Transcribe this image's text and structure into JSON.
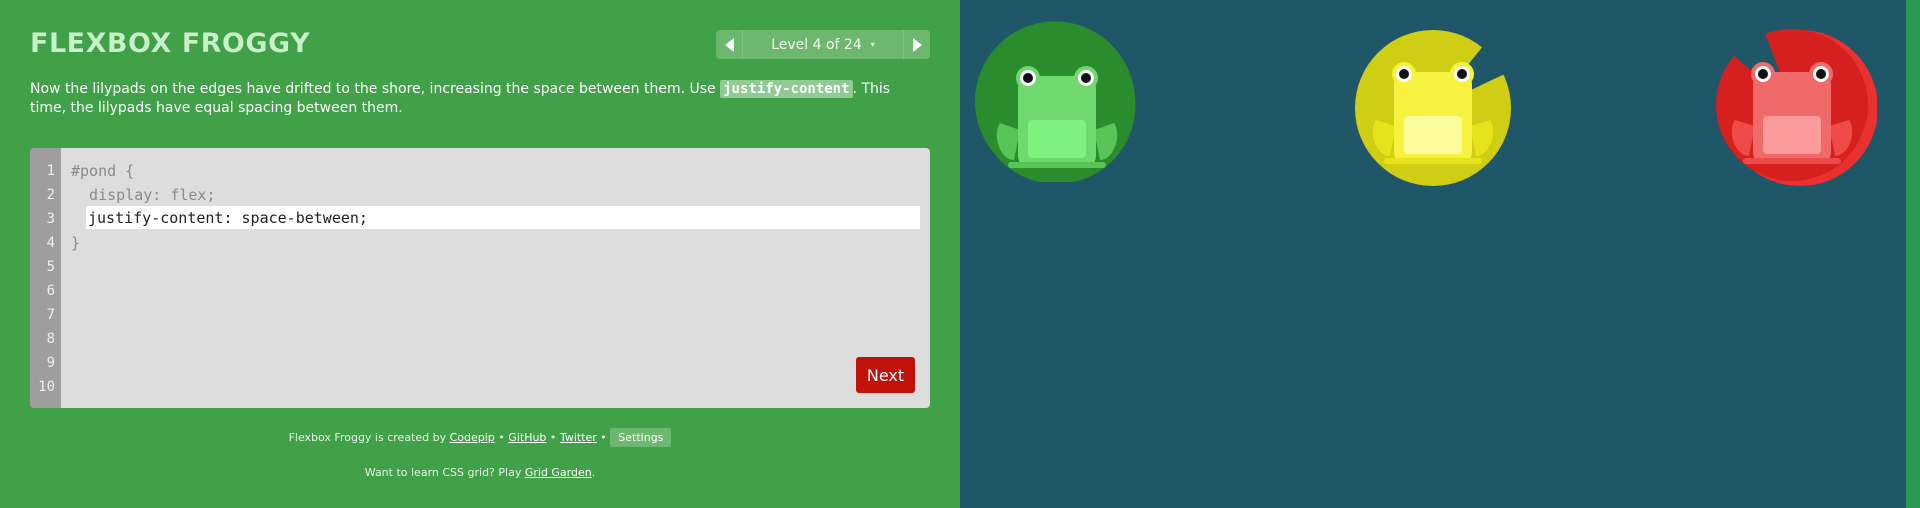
{
  "header": {
    "logo_text": "FLEXBOX FROGGY",
    "level_label": "Level 4 of 24",
    "level_caret": "▾"
  },
  "instructions": {
    "text_before": "Now the lilypads on the edges have drifted to the shore, increasing the space between them. Use ",
    "code": "justify-content",
    "text_after": ". This time, the lilypads have equal spacing between them."
  },
  "editor": {
    "line_numbers": [
      "1",
      "2",
      "3",
      "4",
      "5",
      "6",
      "7",
      "8",
      "9",
      "10"
    ],
    "line1": "#pond {",
    "line2": "  display: flex;",
    "input_value": "justify-content: space-between;",
    "line4": "}",
    "next_label": "Next"
  },
  "footer": {
    "credits_prefix": "Flexbox Froggy is created by",
    "codepip": "Codepip",
    "github": "GitHub",
    "twitter": "Twitter",
    "bullet": "•",
    "settings": "Settings",
    "promo_prefix": "Want to learn CSS grid? Play",
    "grid_garden": "Grid Garden",
    "promo_suffix": "."
  },
  "pond": {
    "colors": {
      "background": "#1f5768",
      "green_pad": "#2a8c2c",
      "green_frog": "#6fd86f",
      "yellow_pad": "#cfcd14",
      "yellow_frog": "#f6f23f",
      "red_pad": "#d5201f",
      "red_frog": "#f06a6a"
    },
    "frogs": [
      "green",
      "yellow",
      "red"
    ]
  }
}
